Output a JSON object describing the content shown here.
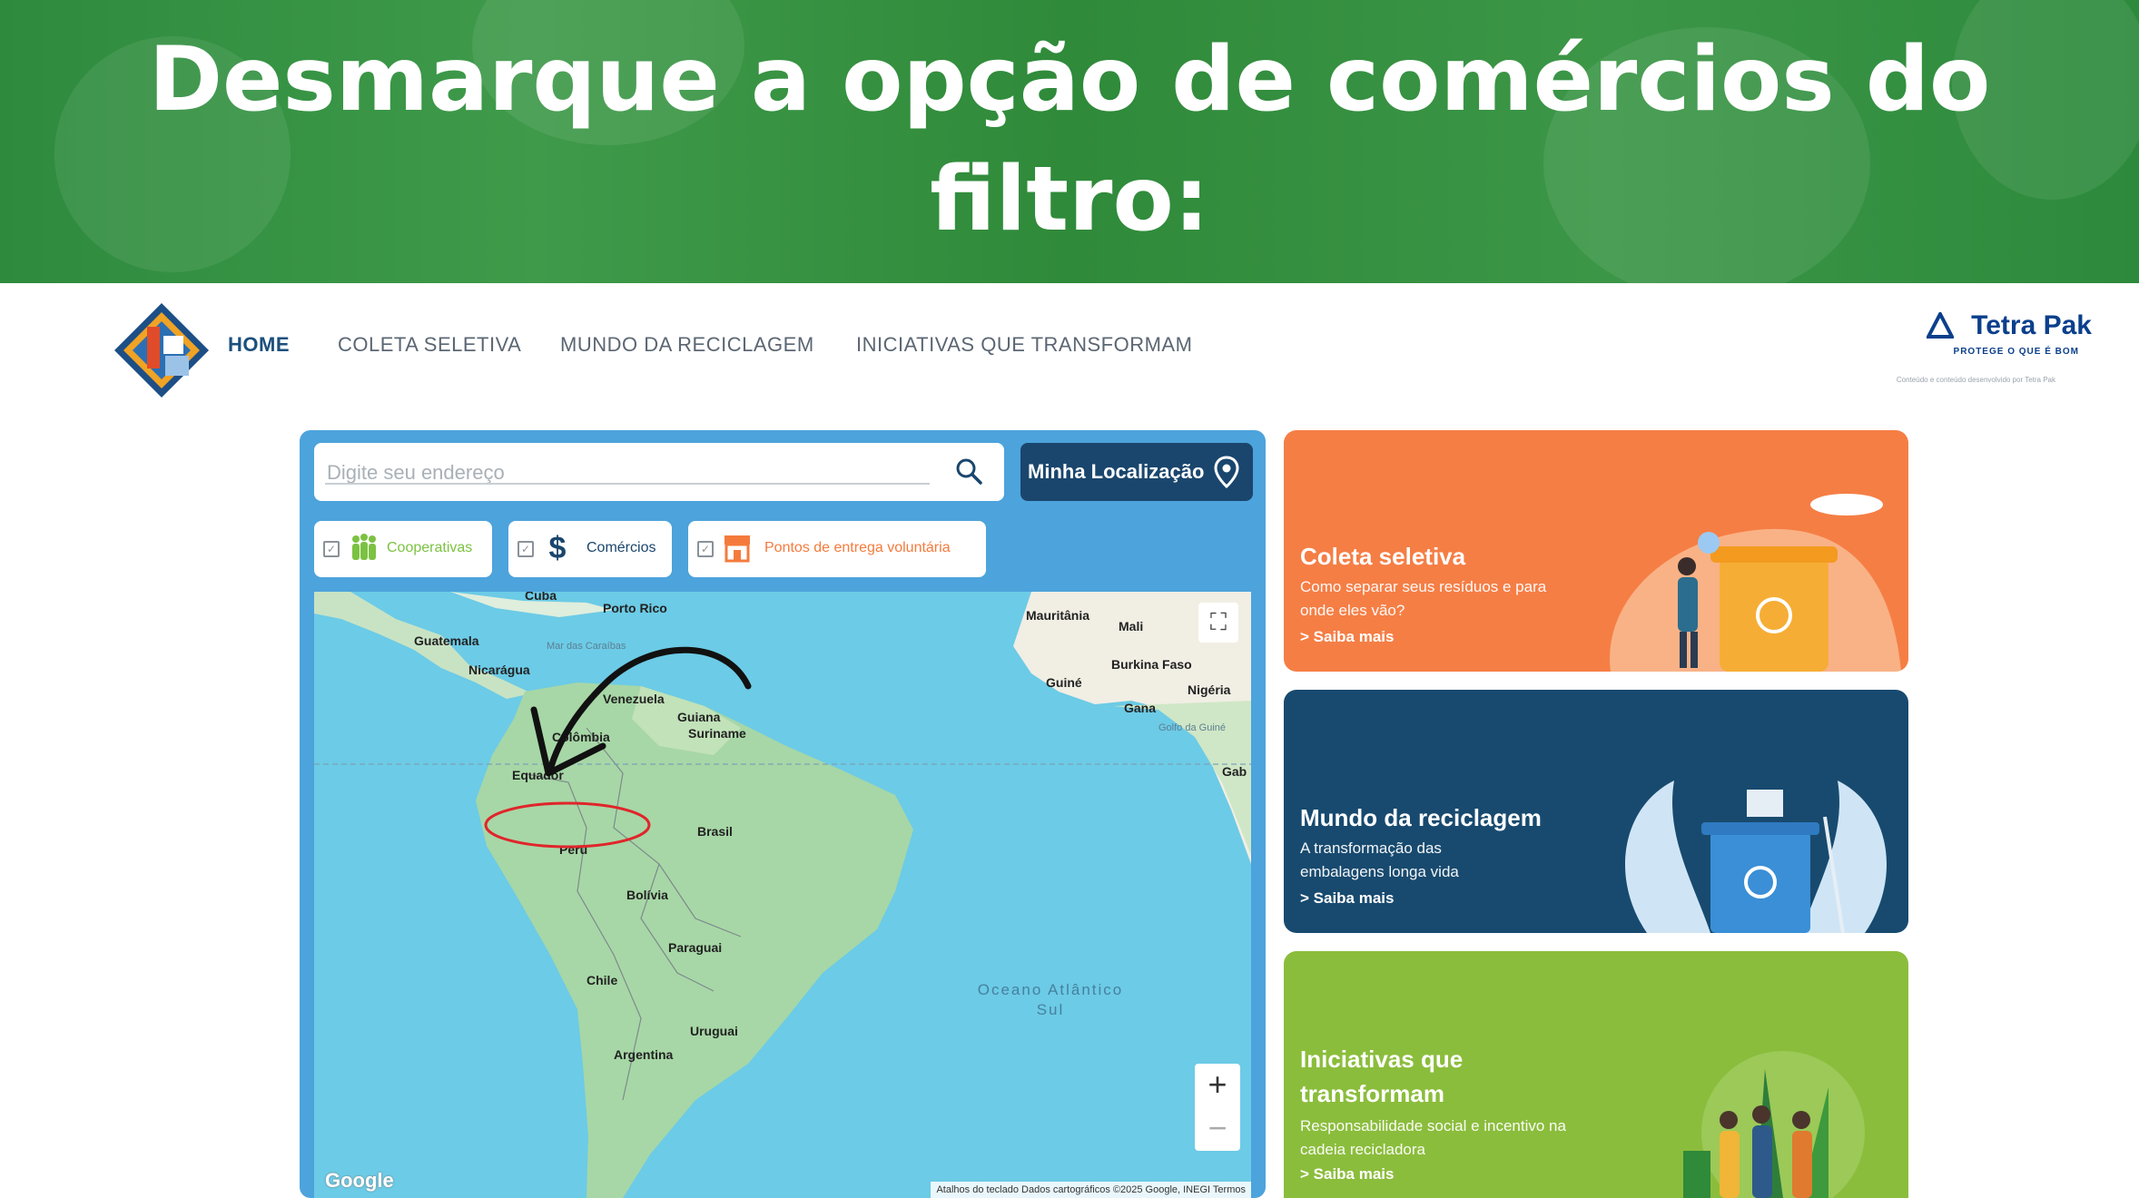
{
  "banner": {
    "title": "Desmarque a opção de comércios do filtro:"
  },
  "nav": {
    "items": [
      "HOME",
      "COLETA SELETIVA",
      "MUNDO DA RECICLAGEM",
      "INICIATIVAS QUE TRANSFORMAM"
    ],
    "brand": {
      "name": "Tetra Pak",
      "tagline": "PROTEGE O QUE É BOM",
      "credit": "Conteúdo e conteúdo desenvolvido por Tetra Pak"
    }
  },
  "search": {
    "placeholder": "Digite seu endereço",
    "location_button": "Minha Localização"
  },
  "filters": [
    {
      "label": "Cooperativas",
      "checked": true,
      "color": "#7cc242",
      "icon": "people-icon"
    },
    {
      "label": "Comércios",
      "checked": true,
      "color": "#1a466d",
      "icon": "dollar-icon"
    },
    {
      "label": "Pontos de entrega voluntária",
      "checked": true,
      "color": "#f47b3c",
      "icon": "store-icon"
    }
  ],
  "map": {
    "labels": [
      "Cuba",
      "Porto Rico",
      "Guatemala",
      "Nicarágua",
      "Venezuela",
      "Guiana",
      "Suriname",
      "Colômbia",
      "Equador",
      "Peru",
      "Brasil",
      "Bolívia",
      "Paraguai",
      "Chile",
      "Uruguai",
      "Argentina",
      "Mauritânia",
      "Mali",
      "Burkina Faso",
      "Guiné",
      "Gana",
      "Nigéria",
      "Gab"
    ],
    "sea_labels": [
      "Mar das Caraíbas",
      "Golfo da Guiné"
    ],
    "ocean_label": "Oceano Atlântico Sul",
    "zoom_in": "+",
    "zoom_out": "−",
    "fullscreen": "⛶",
    "google": "Google",
    "attribution": "Atalhos do teclado   Dados cartográficos ©2025 Google, INEGI   Termos"
  },
  "cards": [
    {
      "title": "Coleta seletiva",
      "desc": "Como separar seus resíduos e para onde eles vão?",
      "more": "> Saiba mais",
      "color": "#f57e45"
    },
    {
      "title": "Mundo da reciclagem",
      "desc": "A transformação das embalagens longa vida",
      "more": "> Saiba mais",
      "color": "#184a6f"
    },
    {
      "title": "Iniciativas que transformam",
      "desc": "Responsabilidade social e incentivo na cadeia recicladora",
      "more": "> Saiba mais",
      "color": "#8bbd3c"
    }
  ],
  "colors": {
    "banner": "#2e8b3e",
    "panel": "#4da3dc",
    "highlight_circle": "#e0252b",
    "arrow": "#111111"
  }
}
